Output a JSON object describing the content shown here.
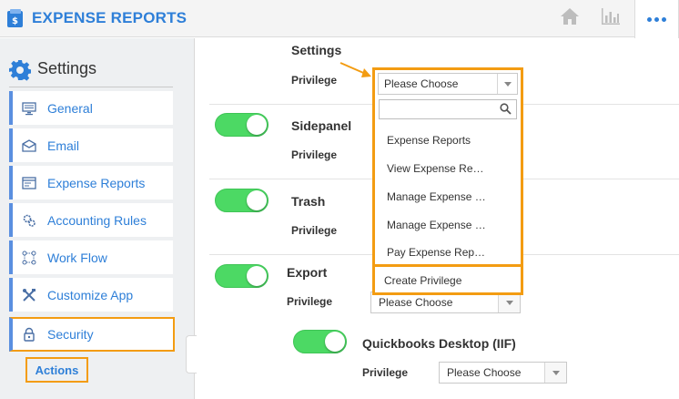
{
  "header": {
    "title": "EXPENSE REPORTS",
    "icons": [
      "wallet-logo-icon",
      "home-icon",
      "bar-chart-icon",
      "more-icon"
    ]
  },
  "sidebar": {
    "title": "Settings",
    "items": [
      {
        "label": "General",
        "icon": "monitor-icon"
      },
      {
        "label": "Email",
        "icon": "envelope-icon"
      },
      {
        "label": "Expense Reports",
        "icon": "window-icon"
      },
      {
        "label": "Accounting Rules",
        "icon": "gears-icon"
      },
      {
        "label": "Work Flow",
        "icon": "workflow-icon"
      },
      {
        "label": "Customize App",
        "icon": "tools-icon"
      },
      {
        "label": "Security",
        "icon": "lock-icon"
      }
    ],
    "actions_label": "Actions"
  },
  "main": {
    "sections": [
      {
        "title": "Settings",
        "privilege_label": "Privilege",
        "toggle_on": null
      },
      {
        "title": "Sidepanel",
        "privilege_label": "Privilege",
        "toggle_on": true
      },
      {
        "title": "Trash",
        "privilege_label": "Privilege",
        "toggle_on": true
      },
      {
        "title": "Export",
        "privilege_label": "Privilege",
        "toggle_on": true,
        "select_value": "Please Choose"
      },
      {
        "title": "Quickbooks Desktop (IIF)",
        "privilege_label": "Privilege",
        "toggle_on": true,
        "select_value": "Please Choose"
      }
    ]
  },
  "dropdown": {
    "selected": "Please Choose",
    "search_placeholder": "",
    "options": [
      "Expense Reports",
      "View Expense Re…",
      "Manage Expense …",
      "Manage Expense …",
      "Pay Expense Rep…"
    ],
    "create_label": "Create Privilege"
  },
  "colors": {
    "accent": "#2e7fd8",
    "highlight": "#f39c12",
    "toggle_on": "#4cd964"
  }
}
